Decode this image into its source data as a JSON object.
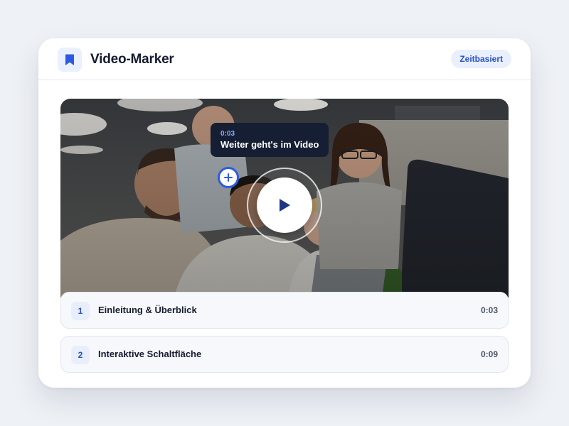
{
  "header": {
    "logo_icon": "bookmark-icon",
    "title": "Video-Marker",
    "badge": "Zeitbasiert"
  },
  "player": {
    "tooltip": {
      "time": "0:03",
      "text": "Weiter geht's im Video"
    },
    "marker_icon": "plus-icon",
    "play_icon": "play-icon",
    "marker_label": "+"
  },
  "chapters": [
    {
      "number": "1",
      "title": "Einleitung & Überblick",
      "time": "0:03"
    },
    {
      "number": "2",
      "title": "Interaktive Schaltfläche",
      "time": "0:09"
    }
  ],
  "colors": {
    "accent": "#2d5be0",
    "badge_text": "#2450c8",
    "tooltip_bg": "#161e33",
    "tooltip_time": "#7fb0ff"
  }
}
